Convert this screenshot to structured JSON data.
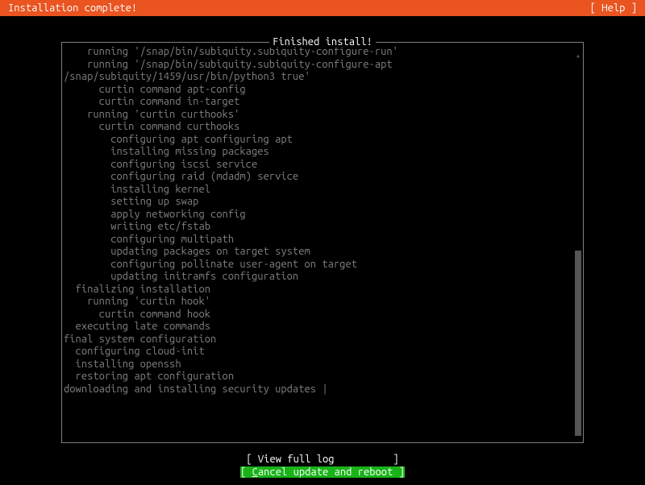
{
  "header": {
    "title": "Installation complete!",
    "help": "[ Help ]"
  },
  "log_box": {
    "title": " Finished install! "
  },
  "log_lines": [
    "    running '/snap/bin/subiquity.subiquity-configure-run'",
    "    running '/snap/bin/subiquity.subiquity-configure-apt",
    "/snap/subiquity/1459/usr/bin/python3 true'",
    "      curtin command apt-config",
    "      curtin command in-target",
    "    running 'curtin curthooks'",
    "      curtin command curthooks",
    "        configuring apt configuring apt",
    "        installing missing packages",
    "        configuring iscsi service",
    "        configuring raid (mdadm) service",
    "        installing kernel",
    "        setting up swap",
    "        apply networking config",
    "        writing etc/fstab",
    "        configuring multipath",
    "        updating packages on target system",
    "        configuring pollinate user-agent on target",
    "        updating initramfs configuration",
    "  finalizing installation",
    "    running 'curtin hook'",
    "      curtin command hook",
    "  executing late commands",
    "final system configuration",
    "  configuring cloud-init",
    "  installing openssh",
    "  restoring apt configuration",
    "downloading and installing security updates |"
  ],
  "buttons": {
    "view_log_prefix": "[ ",
    "view_log_label": "View full log",
    "view_log_suffix": "          ]",
    "cancel_prefix": "[ ",
    "cancel_hotkey": "C",
    "cancel_rest": "ancel update and reboot ]"
  }
}
